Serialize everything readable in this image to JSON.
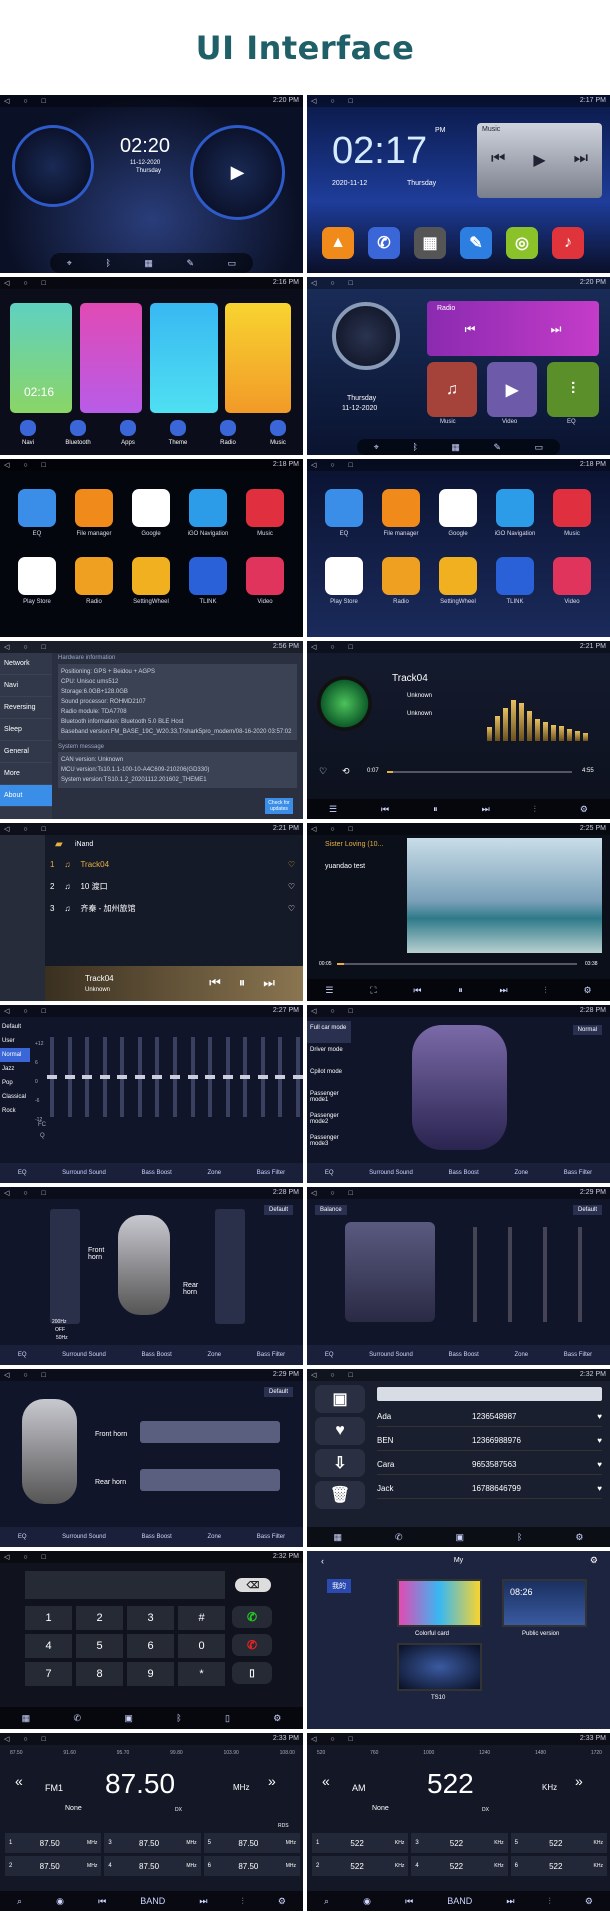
{
  "title": "UI Interface",
  "p1": {
    "time": "2:20 PM",
    "clock": "02:20",
    "date": "11-12-2020",
    "day": "Thursday"
  },
  "p2": {
    "time": "2:17 PM",
    "clock": "02:17",
    "pm": "PM",
    "date": "2020-11-12",
    "day": "Thursday",
    "music": "Music"
  },
  "p3": {
    "time": "2:16 PM",
    "clock": "02:16",
    "tiles": [
      "Navi",
      "Bluetooth",
      "Apps",
      "Theme",
      "Radio",
      "Music"
    ]
  },
  "p4": {
    "time": "2:20 PM",
    "radio": "Radio",
    "day": "Thursday",
    "date": "11-12-2020",
    "tiles": [
      "Music",
      "Video",
      "EQ"
    ]
  },
  "p5": {
    "time": "2:18 PM",
    "row1": [
      "EQ",
      "File manager",
      "Google",
      "iGO Navigation",
      "Music"
    ],
    "row2": [
      "Play Store",
      "Radio",
      "SettingWheel",
      "TLINK",
      "Video"
    ]
  },
  "p6": {
    "time": "2:18 PM",
    "row1": [
      "EQ",
      "File manager",
      "Google",
      "iGO Navigation",
      "Music"
    ],
    "row2": [
      "Play Store",
      "Radio",
      "SettingWheel",
      "TLINK",
      "Video"
    ]
  },
  "p7": {
    "time": "2:56 PM",
    "menu": [
      "Network",
      "Navi",
      "Reversing",
      "Sleep",
      "General",
      "More",
      "About"
    ],
    "hw": "Hardware information",
    "lines": [
      "Positioning: GPS + Beidou + AGPS",
      "CPU: Unisoc ums512",
      "Storage:6.0GB+128.0GB",
      "Sound processor: ROHMD2107",
      "Radio module: TDA7708",
      "Bluetooth information: Bluetooth 5.0 BLE Host",
      "Baseband version:FM_BASE_19C_W20.33,T/shark5pro_modem/08-16-2020 03:57:02"
    ],
    "sys": "System message",
    "sys_lines": [
      "CAN version: Unknown",
      "MCU version:Ts10.1.1-100-10-A4C609-210206(GD330)",
      "System version:TS10.1.2_20201112.201602_THEME1"
    ],
    "check": "Check for updates"
  },
  "p8": {
    "time": "2:21 PM",
    "track": "Track04",
    "artist": "Unknown",
    "album": "Unknown",
    "t0": "0:07",
    "t1": "4:55",
    "progress": 0.03
  },
  "p9": {
    "time": "2:21 PM",
    "folder": "iNand",
    "rows": [
      {
        "n": "1",
        "t": "Track04"
      },
      {
        "n": "2",
        "t": "10 渡口"
      },
      {
        "n": "3",
        "t": "齐秦 - 加州旅馆"
      }
    ],
    "track": "Track04",
    "artist": "Unknown"
  },
  "p10": {
    "time": "2:25 PM",
    "file": "Sister Loving (10...",
    "sub": "yuandao test",
    "t0": "00:05",
    "t1": "03:38",
    "progress": 0.03
  },
  "p11": {
    "time": "2:27 PM",
    "presets": [
      "Default",
      "User",
      "Normal",
      "Jazz",
      "Pop",
      "Classical",
      "Rock"
    ],
    "scale": [
      "+12",
      "6",
      "0",
      "-6",
      "-12"
    ],
    "fc": "FC",
    "q": "Q",
    "tabs": [
      "EQ",
      "Surround Sound",
      "Bass Boost",
      "Zone",
      "Bass Filter"
    ]
  },
  "p12": {
    "time": "2:28 PM",
    "modes": [
      "Full car mode",
      "Driver mode",
      "Cpilot mode",
      "Passenger mode1",
      "Passenger mode2",
      "Passenger mode3"
    ],
    "normal": "Normal",
    "tabs": [
      "EQ",
      "Surround Sound",
      "Bass Boost",
      "Zone",
      "Bass Filter"
    ]
  },
  "p13": {
    "time": "2:28 PM",
    "def": "Default",
    "front": "Front horn",
    "rear": "Rear horn",
    "off": "OFF",
    "f1": "200Hz",
    "f2": "50Hz",
    "tabs": [
      "EQ",
      "Surround Sound",
      "Bass Boost",
      "Zone",
      "Bass Filter"
    ]
  },
  "p14": {
    "time": "2:29 PM",
    "bal": "Balance",
    "def": "Default",
    "tabs": [
      "EQ",
      "Surround Sound",
      "Bass Boost",
      "Zone",
      "Bass Filter"
    ]
  },
  "p15": {
    "time": "2:29 PM",
    "def": "Default",
    "front": "Front horn",
    "rear": "Rear horn",
    "tabs": [
      "EQ",
      "Surround Sound",
      "Bass Boost",
      "Zone",
      "Bass Filter"
    ]
  },
  "p16": {
    "time": "2:32 PM",
    "contacts": [
      {
        "n": "Ada",
        "p": "1236548987"
      },
      {
        "n": "BEN",
        "p": "12366988976"
      },
      {
        "n": "Cara",
        "p": "9653587563"
      },
      {
        "n": "Jack",
        "p": "16788646799"
      }
    ]
  },
  "p17": {
    "time": "2:32 PM",
    "keys": [
      "1",
      "2",
      "3",
      "#",
      "4",
      "5",
      "6",
      "0",
      "7",
      "8",
      "9",
      "*"
    ]
  },
  "p18": {
    "title": "My",
    "tab": "我的",
    "c1": "Colorful card",
    "c2": "Public version",
    "c3": "TS10",
    "clock": "08:26"
  },
  "p19": {
    "time": "2:33 PM",
    "scale": [
      "87.50",
      "91.60",
      "95.70",
      "99.80",
      "103.90",
      "108.00"
    ],
    "band": "FM1",
    "freq": "87.50",
    "unit": "MHz",
    "none": "None",
    "dx": "DX",
    "rds": "RDS",
    "presets": [
      "1",
      "87.50",
      "MHz",
      "3",
      "87.50",
      "MHz",
      "5",
      "87.50",
      "MHz",
      "2",
      "87.50",
      "MHz",
      "4",
      "87.50",
      "MHz",
      "6",
      "87.50",
      "MHz"
    ],
    "bandbtn": "BAND"
  },
  "p20": {
    "time": "2:33 PM",
    "scale": [
      "520",
      "760",
      "1000",
      "1240",
      "1480",
      "1720"
    ],
    "band": "AM",
    "freq": "522",
    "unit": "KHz",
    "none": "None",
    "dx": "DX",
    "presets": [
      "1",
      "522",
      "KHz",
      "3",
      "522",
      "KHz",
      "5",
      "522",
      "KHz",
      "2",
      "522",
      "KHz",
      "4",
      "522",
      "KHz",
      "6",
      "522",
      "KHz"
    ],
    "bandbtn": "BAND"
  }
}
